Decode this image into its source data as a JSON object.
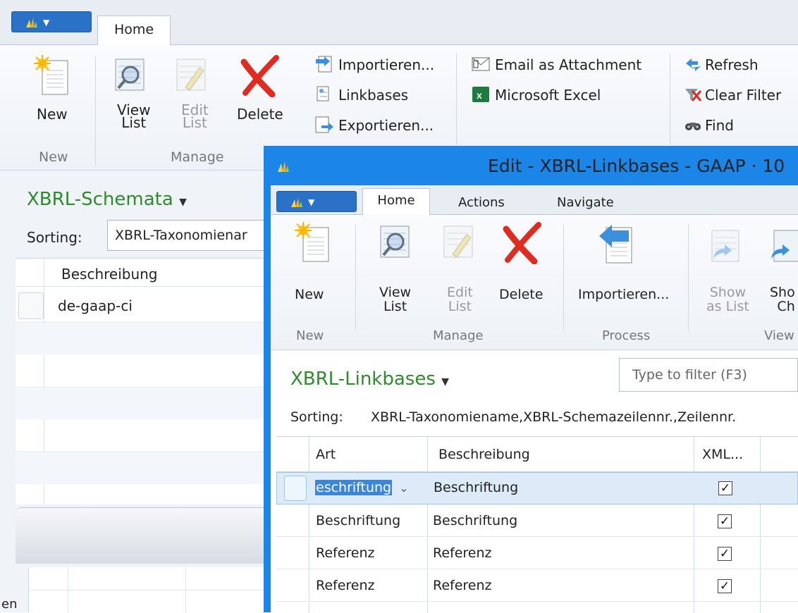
{
  "bg": {
    "tab_home": "Home",
    "actions": {
      "new": "New",
      "view_list": "View\nList",
      "edit_list": "Edit\nList",
      "delete": "Delete"
    },
    "groups": {
      "new": "New",
      "manage": "Manage"
    },
    "small_actions": {
      "import": "Importieren...",
      "linkbases": "Linkbases",
      "export": "Exportieren...",
      "email": "Email as Attachment",
      "excel": "Microsoft Excel",
      "refresh": "Refresh",
      "clear_filter": "Clear Filter",
      "find": "Find"
    },
    "page_title": "XBRL-Schemata",
    "sorting_label": "Sorting:",
    "sorting_value": "XBRL-Taxonomienar",
    "column": "Beschreibung",
    "rows": [
      "de-gaap-ci"
    ],
    "bottom_fragment": "en"
  },
  "dialog": {
    "title": "Edit - XBRL-Linkbases - GAAP · 10",
    "tabs": [
      "Home",
      "Actions",
      "Navigate"
    ],
    "actions": {
      "new": "New",
      "view_list": "View\nList",
      "edit_list": "Edit\nList",
      "delete": "Delete",
      "import": "Importieren...",
      "show_as_list": "Show\nas List",
      "show_chart": "Sho\nCh"
    },
    "groups": {
      "new": "New",
      "manage": "Manage",
      "process": "Process",
      "view": "View"
    },
    "page_title": "XBRL-Linkbases",
    "filter_placeholder": "Type to filter (F3)",
    "sorting_label": "Sorting:",
    "sorting_value": "XBRL-Taxonomiename,XBRL-Schemazeilennr.,Zeilennr.",
    "columns": [
      "Art",
      "Beschreibung",
      "XML..."
    ],
    "rows": [
      {
        "art": "eschriftung",
        "beschreibung": "Beschriftung",
        "xml": "✓",
        "selected": true
      },
      {
        "art": "Beschriftung",
        "beschreibung": "Beschriftung",
        "xml": "✓"
      },
      {
        "art": "Referenz",
        "beschreibung": "Referenz",
        "xml": "✓"
      },
      {
        "art": "Referenz",
        "beschreibung": "Referenz",
        "xml": "✓"
      }
    ]
  },
  "colors": {
    "accent": "#2a72c7",
    "title_green": "#2e8b2e",
    "selected_row": "#dcebf7"
  }
}
